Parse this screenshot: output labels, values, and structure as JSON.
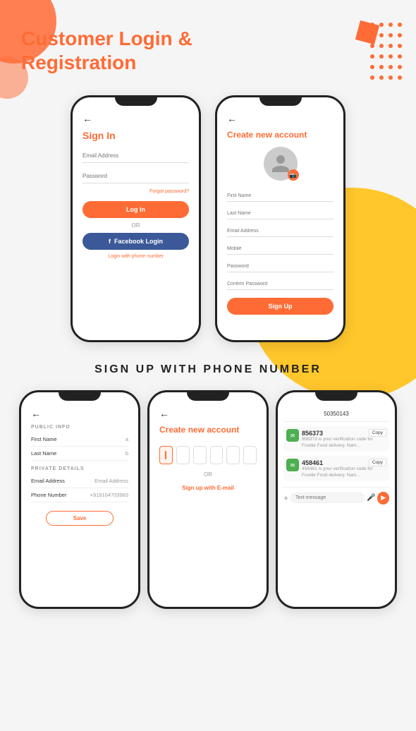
{
  "page": {
    "background": "#f5f5f5"
  },
  "header": {
    "title_line1": "Customer Login &",
    "title_line2": "Registration"
  },
  "section_phone_title": "SIGN UP WITH PHONE NUMBER",
  "phone1": {
    "back": "←",
    "title": "Sign In",
    "email_placeholder": "Email Address",
    "password_placeholder": "Password",
    "forgot_label": "Forgot password?",
    "login_btn": "Log In",
    "or_label": "OR",
    "facebook_btn": "Facebook Login",
    "phone_link": "Login with phone number"
  },
  "phone2": {
    "back": "←",
    "title": "Create new account",
    "first_name": "First Name",
    "last_name": "Last Name",
    "email": "Email Address",
    "mobile": "Mobile",
    "password": "Password",
    "confirm_password": "Confirm Password",
    "signup_btn": "Sign Up"
  },
  "phone3": {
    "back": "←",
    "public_info_label": "PUBLIC INFO",
    "first_name_label": "First Name",
    "first_name_value": "a",
    "last_name_label": "Last Name",
    "last_name_value": "b",
    "private_details_label": "PRIVATE DETAILS",
    "email_label": "Email Address",
    "email_value": "Email Address",
    "phone_label": "Phone Number",
    "phone_value": "+919104703983",
    "save_btn": "Save"
  },
  "phone4": {
    "back": "←",
    "title": "Create new account",
    "or_label": "OR",
    "email_link": "Sign up with E-mail",
    "otp_boxes": [
      "",
      "",
      "",
      "",
      "",
      ""
    ]
  },
  "phone5": {
    "back": "←",
    "phone_number": "50350143",
    "sms_items": [
      {
        "code": "856373",
        "text": "856373 is your verification code for Foodie Food delivery. Nam...",
        "copy_label": "Copy"
      },
      {
        "code": "458461",
        "text": "458461 is your verification code for Foodie Food delivery. Nam...",
        "copy_label": "Copy"
      }
    ],
    "input_placeholder": "Text message"
  }
}
